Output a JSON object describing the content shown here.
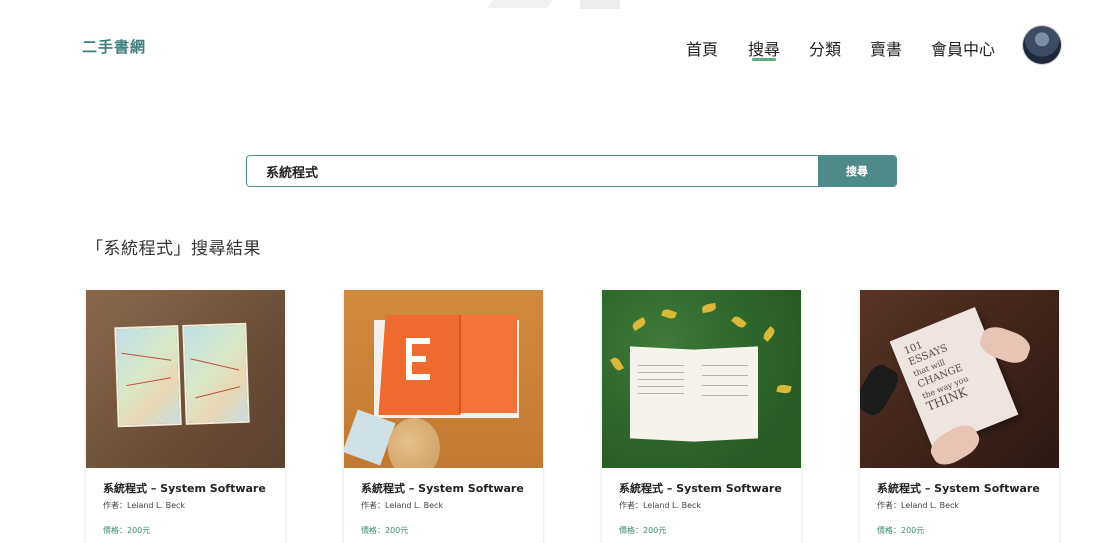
{
  "header": {
    "logo": "二手書網",
    "nav": [
      {
        "label": "首頁",
        "active": false
      },
      {
        "label": "搜尋",
        "active": true
      },
      {
        "label": "分類",
        "active": false
      },
      {
        "label": "賣書",
        "active": false
      },
      {
        "label": "會員中心",
        "active": false
      }
    ]
  },
  "search": {
    "value": "系統程式",
    "button_label": "搜尋"
  },
  "results": {
    "title": "「系統程式」搜尋結果",
    "cards": [
      {
        "title": "系統程式 – System Software",
        "author": "作者：Leland L. Beck",
        "price": "價格：200元"
      },
      {
        "title": "系統程式 – System Software",
        "author": "作者：Leland L. Beck",
        "price": "價格：200元"
      },
      {
        "title": "系統程式 – System Software",
        "author": "作者：Leland L. Beck",
        "price": "價格：200元"
      },
      {
        "title": "系統程式 – System Software",
        "author": "作者：Leland L. Beck",
        "price": "價格：200元"
      }
    ]
  },
  "cover4_text": [
    "101",
    "ESSAYS",
    "that will",
    "CHANGE",
    "the way you",
    "THINK"
  ],
  "colors": {
    "accent": "#4e8a87",
    "nav_underline": "#58b07f",
    "price": "#3f8a73"
  }
}
